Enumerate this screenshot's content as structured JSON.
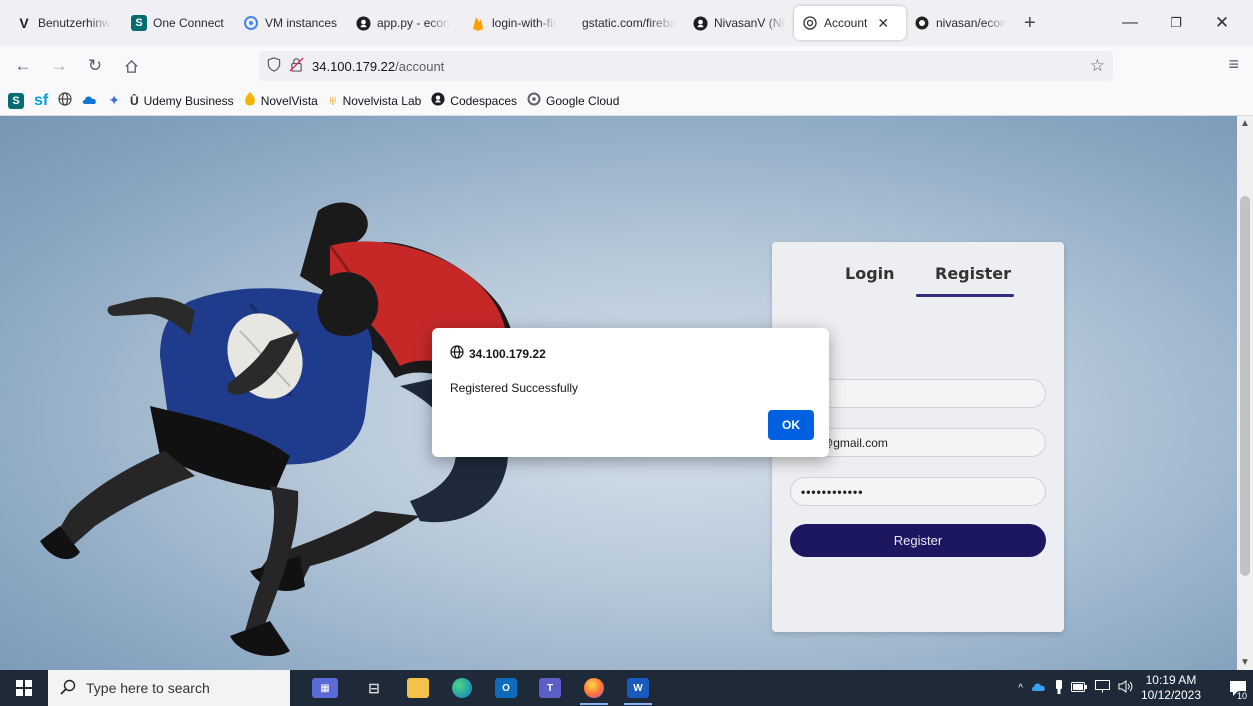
{
  "browser": {
    "tabs": [
      {
        "label": "Benutzerhinw",
        "icon": "v-logo-icon",
        "active": false
      },
      {
        "label": "One Connect",
        "icon": "sharepoint-icon",
        "active": false
      },
      {
        "label": "VM instances",
        "icon": "gcp-icon",
        "active": false
      },
      {
        "label": "app.py - econ",
        "icon": "github-icon",
        "active": false
      },
      {
        "label": "login-with-fir",
        "icon": "firebase-icon",
        "active": false
      },
      {
        "label": "gstatic.com/fireba",
        "icon": "",
        "active": false
      },
      {
        "label": "NivasanV (Niv",
        "icon": "github-icon",
        "active": false
      },
      {
        "label": "Account",
        "icon": "openai-icon",
        "active": true
      },
      {
        "label": "nivasan/ecom",
        "icon": "chatgpt-icon",
        "active": false
      }
    ],
    "url_host": "34.100.179.22",
    "url_path": "/account",
    "bookmarks": [
      {
        "label": "",
        "icon": "sharepoint-icon"
      },
      {
        "label": "",
        "icon": "salesforce-icon"
      },
      {
        "label": "",
        "icon": "globe-icon"
      },
      {
        "label": "",
        "icon": "onedrive-icon"
      },
      {
        "label": "",
        "icon": "sparkle-icon"
      },
      {
        "label": "Udemy Business",
        "icon": "udemy-icon"
      },
      {
        "label": "NovelVista",
        "icon": "novelvista-icon"
      },
      {
        "label": "Novelvista Lab",
        "icon": "novelvista-lab-icon"
      },
      {
        "label": "Codespaces",
        "icon": "github-icon"
      },
      {
        "label": "Google Cloud",
        "icon": "google-cloud-icon"
      }
    ]
  },
  "auth": {
    "login_tab": "Login",
    "register_tab": "Register",
    "active_tab": "Register",
    "username_value": "oup",
    "email_value": "oup@gmail.com",
    "password_value": "••••••••••••",
    "register_button": "Register"
  },
  "dialog": {
    "origin": "34.100.179.22",
    "message": "Registered Successfully",
    "ok_label": "OK"
  },
  "taskbar": {
    "search_placeholder": "Type here to search",
    "time": "10:19 AM",
    "date": "10/12/2023",
    "notification_count": "10"
  },
  "colors": {
    "accent_blue": "#0061e0",
    "register_button": "#1b1760",
    "tab_underline": "#2f2d7a",
    "taskbar": "#1f2a38"
  }
}
